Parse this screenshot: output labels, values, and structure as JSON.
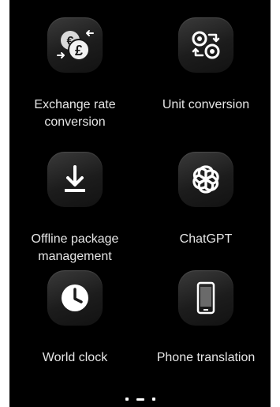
{
  "tiles": [
    {
      "label": "Exchange rate\nconversion",
      "icon": "currency-exchange-icon"
    },
    {
      "label": "Unit conversion",
      "icon": "unit-conversion-icon"
    },
    {
      "label": "Offline package\nmanagement",
      "icon": "download-icon"
    },
    {
      "label": "ChatGPT",
      "icon": "chatgpt-icon"
    },
    {
      "label": "World clock",
      "icon": "clock-icon"
    },
    {
      "label": "Phone translation",
      "icon": "phone-icon"
    }
  ],
  "pager": {
    "pages": 3,
    "active_index": 1
  }
}
